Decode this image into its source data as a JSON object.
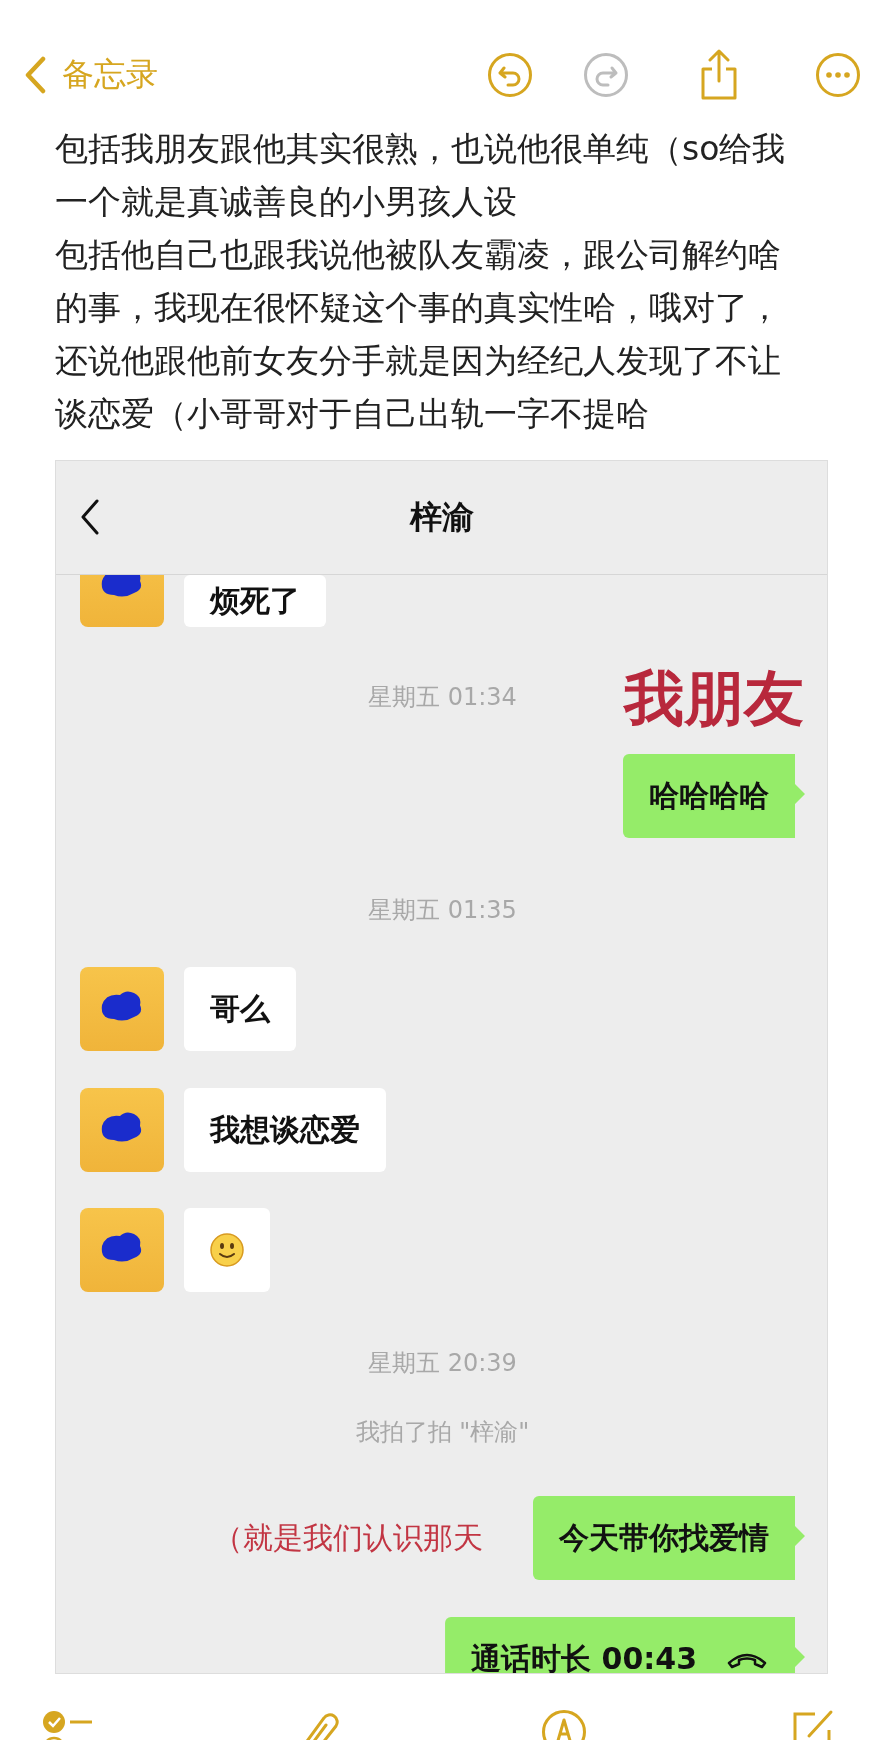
{
  "nav": {
    "back_label": "备忘录",
    "undo_disabled": false,
    "redo_disabled": true
  },
  "paragraphs": [
    "包括我朋友跟他其实很熟，也说他很单纯（so给我一个就是真诚善良的小男孩人设",
    "包括他自己也跟我说他被队友霸凌，跟公司解约啥的事，我现在很怀疑这个事的真实性哈，哦对了，还说他跟他前女友分手就是因为经纪人发现了不让谈恋爱（小哥哥对于自己出轨一字不提哈"
  ],
  "chat": {
    "title": "梓渝",
    "annotation": "我朋友",
    "messages": [
      {
        "kind": "incoming",
        "text": "烦死了"
      },
      {
        "kind": "time",
        "text": "星期五 01:34"
      },
      {
        "kind": "outgoing",
        "text": "哈哈哈哈"
      },
      {
        "kind": "time",
        "text": "星期五 01:35"
      },
      {
        "kind": "incoming",
        "text": "哥么"
      },
      {
        "kind": "incoming",
        "text": "我想谈恋爱"
      },
      {
        "kind": "incoming_emoji"
      },
      {
        "kind": "time",
        "text": "星期五 20:39"
      },
      {
        "kind": "system",
        "text": "我拍了拍 \"梓渝\""
      },
      {
        "kind": "outgoing",
        "text": "今天带你找爱情",
        "note": "（就是我们认识那天"
      },
      {
        "kind": "call",
        "text": "通话时长 00:43"
      }
    ]
  }
}
